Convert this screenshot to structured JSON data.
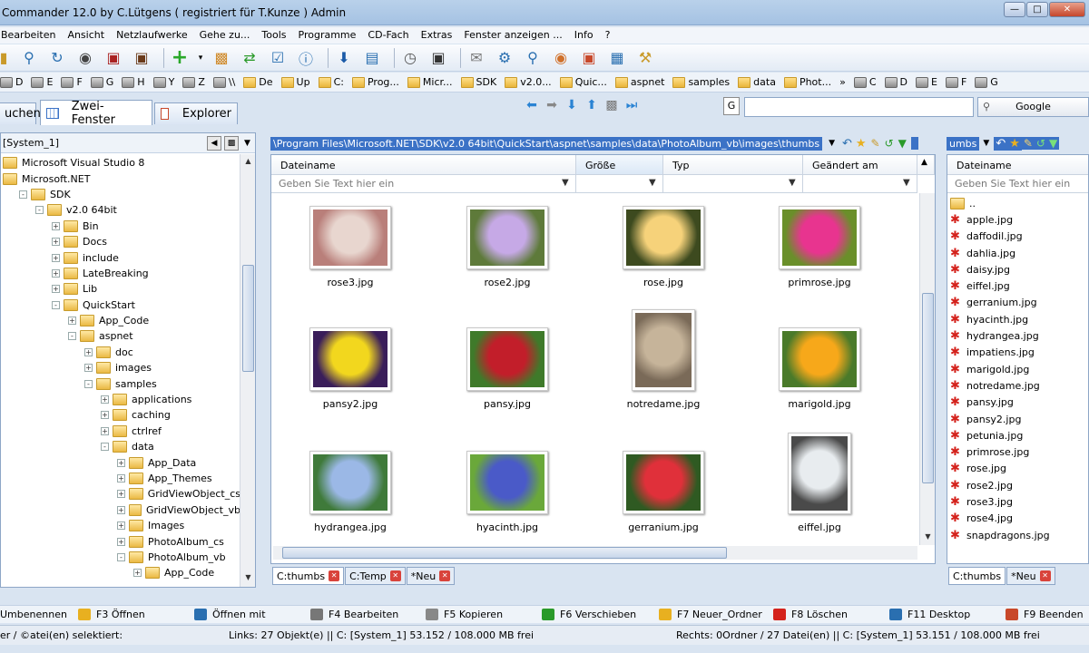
{
  "window": {
    "title": "Commander 12.0   by C.Lütgens ( registriert für T.Kunze ) Admin"
  },
  "menu": [
    "Bearbeiten",
    "Ansicht",
    "Netzlaufwerke",
    "Gehe zu...",
    "Tools",
    "Programme",
    "CD-Fach",
    "Extras",
    "Fenster anzeigen ...",
    "Info",
    "?"
  ],
  "drives": [
    "D",
    "E",
    "F",
    "G",
    "H",
    "Y",
    "Z",
    "\\\\",
    "De",
    "Up",
    "C:",
    "Prog...",
    "Micr...",
    "SDK",
    "v2.0...",
    "Quic...",
    "aspnet",
    "samples",
    "data",
    "Phot...",
    "»",
    "C",
    "D",
    "E",
    "F",
    "G"
  ],
  "main_tabs": {
    "suchen": "uchen",
    "zwei": "Zwei-Fenster",
    "explorer": "Explorer"
  },
  "search": {
    "placeholder": "",
    "google_label": "Google",
    "g_label": "G"
  },
  "left_panel": {
    "drive_label": "[System_1]",
    "tree": [
      {
        "label": "Microsoft Visual Studio 8",
        "indent": 0,
        "exp": ""
      },
      {
        "label": "Microsoft.NET",
        "indent": 0,
        "exp": ""
      },
      {
        "label": "SDK",
        "indent": 1,
        "exp": "-"
      },
      {
        "label": "v2.0 64bit",
        "indent": 2,
        "exp": "-"
      },
      {
        "label": "Bin",
        "indent": 3,
        "exp": "+"
      },
      {
        "label": "Docs",
        "indent": 3,
        "exp": "+"
      },
      {
        "label": "include",
        "indent": 3,
        "exp": "+"
      },
      {
        "label": "LateBreaking",
        "indent": 3,
        "exp": "+"
      },
      {
        "label": "Lib",
        "indent": 3,
        "exp": "+"
      },
      {
        "label": "QuickStart",
        "indent": 3,
        "exp": "-"
      },
      {
        "label": "App_Code",
        "indent": 4,
        "exp": "+"
      },
      {
        "label": "aspnet",
        "indent": 4,
        "exp": "-"
      },
      {
        "label": "doc",
        "indent": 5,
        "exp": "+"
      },
      {
        "label": "images",
        "indent": 5,
        "exp": "+"
      },
      {
        "label": "samples",
        "indent": 5,
        "exp": "-"
      },
      {
        "label": "applications",
        "indent": 6,
        "exp": "+"
      },
      {
        "label": "caching",
        "indent": 6,
        "exp": "+"
      },
      {
        "label": "ctrlref",
        "indent": 6,
        "exp": "+"
      },
      {
        "label": "data",
        "indent": 6,
        "exp": "-"
      },
      {
        "label": "App_Data",
        "indent": 7,
        "exp": "+"
      },
      {
        "label": "App_Themes",
        "indent": 7,
        "exp": "+"
      },
      {
        "label": "GridViewObject_cs",
        "indent": 7,
        "exp": "+"
      },
      {
        "label": "GridViewObject_vb",
        "indent": 7,
        "exp": "+"
      },
      {
        "label": "Images",
        "indent": 7,
        "exp": "+"
      },
      {
        "label": "PhotoAlbum_cs",
        "indent": 7,
        "exp": "+"
      },
      {
        "label": "PhotoAlbum_vb",
        "indent": 7,
        "exp": "-"
      },
      {
        "label": "App_Code",
        "indent": 8,
        "exp": "+"
      }
    ]
  },
  "center_panel": {
    "path": "\\Program Files\\Microsoft.NET\\SDK\\v2.0 64bit\\QuickStart\\aspnet\\samples\\data\\PhotoAlbum_vb\\images\\thumbs",
    "columns": [
      "Dateiname",
      "Größe",
      "Typ",
      "Geändert am"
    ],
    "filter_placeholder": "Geben Sie Text hier ein",
    "thumbnails": [
      {
        "name": "rose3.jpg",
        "c1": "#e8d6cf",
        "c2": "#b97f7a"
      },
      {
        "name": "rose2.jpg",
        "c1": "#c6a9e6",
        "c2": "#5e7a3a"
      },
      {
        "name": "rose.jpg",
        "c1": "#f6d27a",
        "c2": "#3d4a1f"
      },
      {
        "name": "primrose.jpg",
        "c1": "#e8348f",
        "c2": "#6a8f2a"
      },
      {
        "name": "pansy2.jpg",
        "c1": "#f2d71e",
        "c2": "#3a1e5a"
      },
      {
        "name": "pansy.jpg",
        "c1": "#c21e2a",
        "c2": "#3f7a2a"
      },
      {
        "name": "notredame.jpg",
        "c1": "#c6b49a",
        "c2": "#7a6a58"
      },
      {
        "name": "marigold.jpg",
        "c1": "#f7a81a",
        "c2": "#4a7a2a"
      },
      {
        "name": "hydrangea.jpg",
        "c1": "#9bb8e6",
        "c2": "#3f7a3a"
      },
      {
        "name": "hyacinth.jpg",
        "c1": "#4a5ac8",
        "c2": "#6aa83a"
      },
      {
        "name": "gerranium.jpg",
        "c1": "#e0303a",
        "c2": "#2f5a22"
      },
      {
        "name": "eiffel.jpg",
        "c1": "#e8ecef",
        "c2": "#4a4a4a"
      }
    ],
    "tabs": [
      "C:thumbs",
      "C:Temp",
      "*Neu"
    ]
  },
  "right_panel": {
    "path": "umbs",
    "column": "Dateiname",
    "filter_placeholder": "Geben Sie Text hier ein",
    "files": [
      "..",
      "apple.jpg",
      "daffodil.jpg",
      "dahlia.jpg",
      "daisy.jpg",
      "eiffel.jpg",
      "gerranium.jpg",
      "hyacinth.jpg",
      "hydrangea.jpg",
      "impatiens.jpg",
      "marigold.jpg",
      "notredame.jpg",
      "pansy.jpg",
      "pansy2.jpg",
      "petunia.jpg",
      "primrose.jpg",
      "rose.jpg",
      "rose2.jpg",
      "rose3.jpg",
      "rose4.jpg",
      "snapdragons.jpg"
    ],
    "tabs": [
      "C:thumbs",
      "*Neu"
    ]
  },
  "fkeys": [
    "Umbenennen",
    "F3  Öffnen",
    "Öffnen mit",
    "F4  Bearbeiten",
    "F5  Kopieren",
    "F6  Verschieben",
    "F7  Neuer_Ordner",
    "F8  Löschen",
    "F11 Desktop",
    "F9  Beenden"
  ],
  "status": {
    "left": "er / ©atei(en) selektiert:",
    "middle": "Links: 27  Objekt(e)  ||  C: [System_1]  53.152 / 108.000 MB frei",
    "right": "Rechts: 0Ordner / 27 Datei(en)  ||  C: [System_1]  53.151 / 108.000 MB frei"
  },
  "colors": {
    "accent": "#3b72c6",
    "tab_close": "#d9433b",
    "folder": "#eab944"
  }
}
